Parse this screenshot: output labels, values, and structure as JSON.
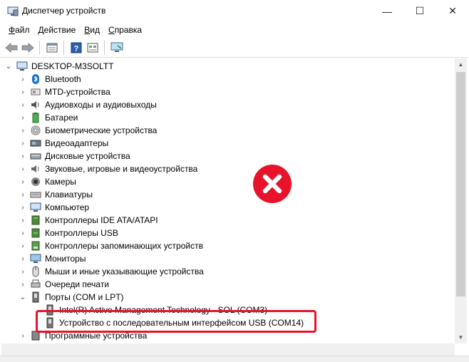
{
  "window": {
    "title": "Диспетчер устройств",
    "minimize_glyph": "—",
    "maximize_glyph": "☐",
    "close_glyph": "✕"
  },
  "menu": {
    "file": {
      "accel": "Ф",
      "rest": "айл"
    },
    "action": {
      "accel": "Д",
      "rest": "ействие"
    },
    "view": {
      "accel": "В",
      "rest": "ид"
    },
    "help": {
      "accel": "С",
      "rest": "правка"
    }
  },
  "tree": {
    "root": "DESKTOP-M3SOLTT",
    "categories": [
      {
        "label": "Bluetooth",
        "icon": "bluetooth-icon"
      },
      {
        "label": "MTD-устройства",
        "icon": "mtd-icon"
      },
      {
        "label": "Аудиовходы и аудиовыходы",
        "icon": "speaker-icon"
      },
      {
        "label": "Батареи",
        "icon": "battery-icon"
      },
      {
        "label": "Биометрические устройства",
        "icon": "fingerprint-icon"
      },
      {
        "label": "Видеоадаптеры",
        "icon": "display-adapter-icon"
      },
      {
        "label": "Дисковые устройства",
        "icon": "disk-drive-icon"
      },
      {
        "label": "Звуковые, игровые и видеоустройства",
        "icon": "sound-icon"
      },
      {
        "label": "Камеры",
        "icon": "camera-icon"
      },
      {
        "label": "Клавиатуры",
        "icon": "keyboard-icon"
      },
      {
        "label": "Компьютер",
        "icon": "computer-icon"
      },
      {
        "label": "Контроллеры IDE ATA/ATAPI",
        "icon": "ide-controller-icon"
      },
      {
        "label": "Контроллеры USB",
        "icon": "usb-icon"
      },
      {
        "label": "Контроллеры запоминающих устройств",
        "icon": "storage-controller-icon"
      },
      {
        "label": "Мониторы",
        "icon": "monitor-icon"
      },
      {
        "label": "Мыши и иные указывающие устройства",
        "icon": "mouse-icon"
      },
      {
        "label": "Очереди печати",
        "icon": "printer-icon"
      },
      {
        "label": "Порты (COM и LPT)",
        "icon": "port-icon",
        "expanded": true
      }
    ],
    "port_children": [
      "Intel(R) Active Management Technology - SOL (COM3)",
      "Устройство с последовательным интерфейсом USB (COM14)"
    ],
    "last_partial": "Программные устройства"
  },
  "colors": {
    "highlight_red": "#e8132a",
    "selection": "#cce8ff"
  }
}
